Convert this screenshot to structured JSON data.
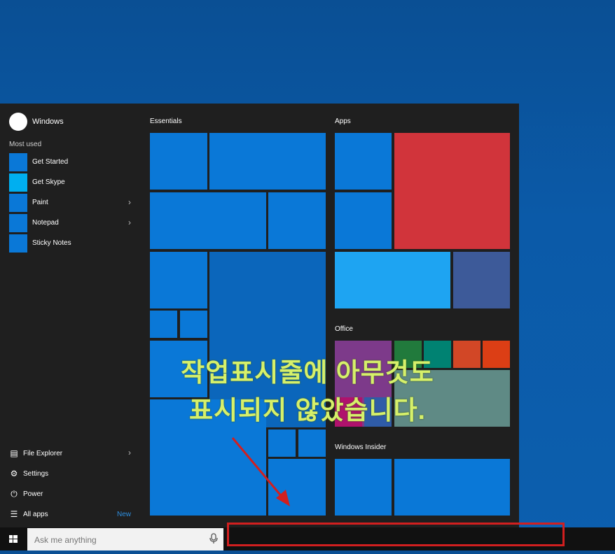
{
  "start_menu": {
    "user": "Windows",
    "most_used_label": "Most used",
    "apps": [
      {
        "label": "Get Started",
        "color": "#0a78d7",
        "chevron": ""
      },
      {
        "label": "Get Skype",
        "color": "#00aff0",
        "chevron": ""
      },
      {
        "label": "Paint",
        "color": "#0a78d7",
        "chevron": "›"
      },
      {
        "label": "Notepad",
        "color": "#0a78d7",
        "chevron": "›"
      },
      {
        "label": "Sticky Notes",
        "color": "#0a78d7",
        "chevron": ""
      }
    ],
    "system": [
      {
        "label": "File Explorer",
        "icon": "file-explorer-icon",
        "glyph": "▤",
        "chevron": "›"
      },
      {
        "label": "Settings",
        "icon": "settings-icon",
        "glyph": "⚙",
        "chevron": ""
      },
      {
        "label": "Power",
        "icon": "power-icon",
        "glyph": "⏻",
        "chevron": ""
      },
      {
        "label": "All apps",
        "icon": "all-apps-icon",
        "glyph": "☰",
        "badge": "New"
      }
    ],
    "groups": {
      "essentials": "Essentials",
      "apps": "Apps",
      "office": "Office",
      "insider": "Windows Insider"
    }
  },
  "taskbar": {
    "search_placeholder": "Ask me anything",
    "mic_glyph": "🎙",
    "win_glyph": "⊞"
  },
  "annotation": {
    "line1": "작업표시줄에 아무것도",
    "line2": "표시되지 않았습니다."
  },
  "colors": {
    "tile_blue": "#0a78d7",
    "tile_red": "#d1343b",
    "tile_light_blue": "#1ea4f2",
    "tile_indigo": "#3d5a99",
    "highlight": "#d21f1f",
    "caption": "#d6f06a"
  }
}
